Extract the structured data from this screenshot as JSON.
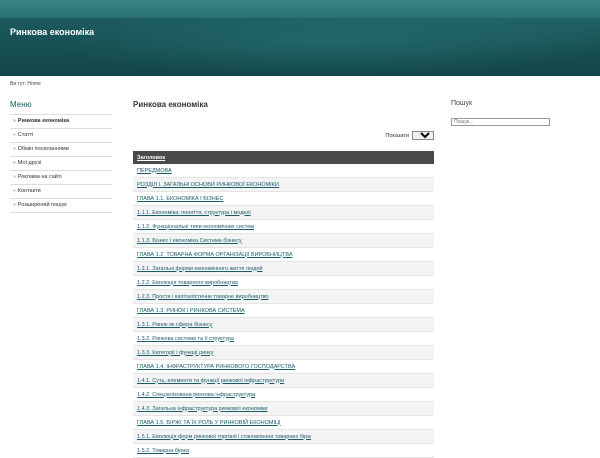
{
  "header": {
    "site_title": "Ринкова економіка"
  },
  "breadcrumb": "Ви тут: Home",
  "sidebar": {
    "title": "Меню",
    "items": [
      "Ринкова економіка",
      "Статті",
      "Обмін посиланнями",
      "Мої друзі",
      "Реклама на сайті",
      "Контакти",
      "Розширений пошук"
    ]
  },
  "main": {
    "title": "Ринкова економіка",
    "show_label": "Показати",
    "show_value": "Всі",
    "table_header": "Заголовок",
    "rows": [
      "ПЕРЕДМОВА",
      "РОЗДІЛ І. ЗАГАЛЬНІ ОСНОВИ РИНКОВОЇ ЕКОНОМІКИ",
      "ГЛАВА 1.1. ЕКОНОМІКА І БІЗНЕС",
      "1.1.1. Економіка: поняття, структура і моделі",
      "1.1.2. Функціональні типи економічних систем",
      "1.1.3. Бізнес і економіка Система бізнесу",
      "ГЛАВА 1.2. ТОВАРНА ФОРМА ОРГАНІЗАЦІЇ ВИРОБНИЦТВА",
      "1.2.1. Загальні форми економічного життя людей",
      "1.2.2. Еволюція товарного виробництва",
      "1.2.3. Просте і капіталістичне товарне виробництво",
      "ГЛАВА 1.3. РИНОК І РИНКОВА СИСТЕМА",
      "1.3.1. Ринок як сфера бізнесу",
      "1.3.2. Ринкова система та її структура",
      "1.3.3. Категорії і функції ринку",
      "ГЛАВА 1.4. ІНФРАСТРУКТУРА РИНКОВОГО ГОСПОДАРСТВА",
      "1.4.1. Суть, елементи та функції ринкової інфраструктури",
      "1.4.2. Спеціалізована ринкова інфраструктура",
      "1.4.3. Загальна інфраструктура ринкової економіки",
      "ГЛАВА 1.5. БІРЖІ ТА ЇХ РОЛЬ У РИНКОВІЙ ЕКОНОМІЦІ",
      "1.5.1. Еволюція форм ринкової торгівлі і становлення товарних бірж",
      "1.5.2. Товарна біржа"
    ]
  },
  "search": {
    "title": "Пошук",
    "placeholder": "Пошук..."
  }
}
